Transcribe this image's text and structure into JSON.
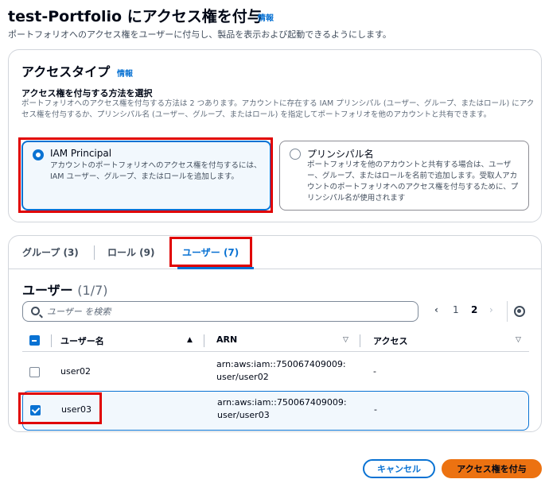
{
  "header": {
    "title": "test-Portfolio にアクセス権を付与",
    "info": "情報",
    "description": "ポートフォリオへのアクセス権をユーザーに付与し、製品を表示および起動できるようにします。"
  },
  "access_type": {
    "title": "アクセスタイプ",
    "info": "情報",
    "subtitle": "アクセス権を付与する方法を選択",
    "description": "ポートフォリオへのアクセス権を付与する方法は 2 つあります。アカウントに存在する IAM プリンシパル (ユーザー、グループ、またはロール) にアクセス権を付与するか、プリンシパル名 (ユーザー、グループ、またはロール) を指定してポートフォリオを他のアカウントと共有できます。",
    "options": [
      {
        "label": "IAM Principal",
        "description": "アカウントのポートフォリオへのアクセス権を付与するには、IAM ユーザー、グループ、またはロールを追加します。",
        "selected": true
      },
      {
        "label": "プリンシパル名",
        "description": "ポートフォリオを他のアカウントと共有する場合は、ユーザー、グループ、またはロールを名前で追加します。受取人アカウントのポートフォリオへのアクセス権を付与するために、プリンシパル名が使用されます",
        "selected": false
      }
    ]
  },
  "tabs": [
    {
      "label": "グループ (3)",
      "active": false
    },
    {
      "label": "ロール (9)",
      "active": false
    },
    {
      "label": "ユーザー (7)",
      "active": true
    }
  ],
  "table": {
    "title": "ユーザー",
    "count": "(1/7)",
    "search_placeholder": "ユーザー を検索",
    "pagination": {
      "prev": "‹",
      "pages": [
        "1",
        "2"
      ],
      "current": "2",
      "next": "›"
    },
    "columns": [
      "ユーザー名",
      "ARN",
      "アクセス"
    ],
    "rows": [
      {
        "name": "user02",
        "arn": "arn:aws:iam::750067409009:user/user02",
        "access": "-",
        "selected": false
      },
      {
        "name": "user03",
        "arn": "arn:aws:iam::750067409009:user/user03",
        "access": "-",
        "selected": true
      }
    ]
  },
  "footer": {
    "cancel": "キャンセル",
    "submit": "アクセス権を付与"
  },
  "colors": {
    "accent": "#0972d3",
    "primary_button": "#ec7211",
    "highlight_box": "#e00000"
  }
}
